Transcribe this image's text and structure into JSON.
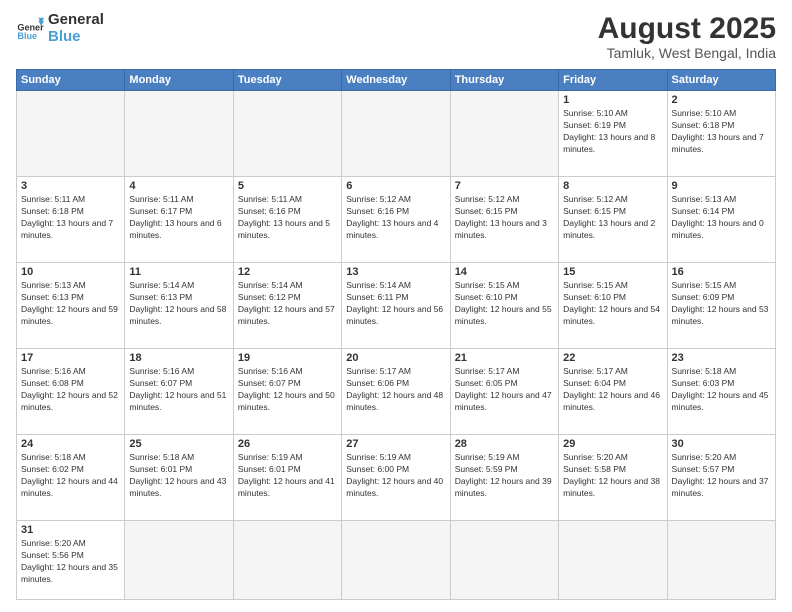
{
  "header": {
    "logo_general": "General",
    "logo_blue": "Blue",
    "title": "August 2025",
    "subtitle": "Tamluk, West Bengal, India"
  },
  "weekdays": [
    "Sunday",
    "Monday",
    "Tuesday",
    "Wednesday",
    "Thursday",
    "Friday",
    "Saturday"
  ],
  "weeks": [
    [
      {
        "day": "",
        "info": ""
      },
      {
        "day": "",
        "info": ""
      },
      {
        "day": "",
        "info": ""
      },
      {
        "day": "",
        "info": ""
      },
      {
        "day": "",
        "info": ""
      },
      {
        "day": "1",
        "info": "Sunrise: 5:10 AM\nSunset: 6:19 PM\nDaylight: 13 hours and 8 minutes."
      },
      {
        "day": "2",
        "info": "Sunrise: 5:10 AM\nSunset: 6:18 PM\nDaylight: 13 hours and 7 minutes."
      }
    ],
    [
      {
        "day": "3",
        "info": "Sunrise: 5:11 AM\nSunset: 6:18 PM\nDaylight: 13 hours and 7 minutes."
      },
      {
        "day": "4",
        "info": "Sunrise: 5:11 AM\nSunset: 6:17 PM\nDaylight: 13 hours and 6 minutes."
      },
      {
        "day": "5",
        "info": "Sunrise: 5:11 AM\nSunset: 6:16 PM\nDaylight: 13 hours and 5 minutes."
      },
      {
        "day": "6",
        "info": "Sunrise: 5:12 AM\nSunset: 6:16 PM\nDaylight: 13 hours and 4 minutes."
      },
      {
        "day": "7",
        "info": "Sunrise: 5:12 AM\nSunset: 6:15 PM\nDaylight: 13 hours and 3 minutes."
      },
      {
        "day": "8",
        "info": "Sunrise: 5:12 AM\nSunset: 6:15 PM\nDaylight: 13 hours and 2 minutes."
      },
      {
        "day": "9",
        "info": "Sunrise: 5:13 AM\nSunset: 6:14 PM\nDaylight: 13 hours and 0 minutes."
      }
    ],
    [
      {
        "day": "10",
        "info": "Sunrise: 5:13 AM\nSunset: 6:13 PM\nDaylight: 12 hours and 59 minutes."
      },
      {
        "day": "11",
        "info": "Sunrise: 5:14 AM\nSunset: 6:13 PM\nDaylight: 12 hours and 58 minutes."
      },
      {
        "day": "12",
        "info": "Sunrise: 5:14 AM\nSunset: 6:12 PM\nDaylight: 12 hours and 57 minutes."
      },
      {
        "day": "13",
        "info": "Sunrise: 5:14 AM\nSunset: 6:11 PM\nDaylight: 12 hours and 56 minutes."
      },
      {
        "day": "14",
        "info": "Sunrise: 5:15 AM\nSunset: 6:10 PM\nDaylight: 12 hours and 55 minutes."
      },
      {
        "day": "15",
        "info": "Sunrise: 5:15 AM\nSunset: 6:10 PM\nDaylight: 12 hours and 54 minutes."
      },
      {
        "day": "16",
        "info": "Sunrise: 5:15 AM\nSunset: 6:09 PM\nDaylight: 12 hours and 53 minutes."
      }
    ],
    [
      {
        "day": "17",
        "info": "Sunrise: 5:16 AM\nSunset: 6:08 PM\nDaylight: 12 hours and 52 minutes."
      },
      {
        "day": "18",
        "info": "Sunrise: 5:16 AM\nSunset: 6:07 PM\nDaylight: 12 hours and 51 minutes."
      },
      {
        "day": "19",
        "info": "Sunrise: 5:16 AM\nSunset: 6:07 PM\nDaylight: 12 hours and 50 minutes."
      },
      {
        "day": "20",
        "info": "Sunrise: 5:17 AM\nSunset: 6:06 PM\nDaylight: 12 hours and 48 minutes."
      },
      {
        "day": "21",
        "info": "Sunrise: 5:17 AM\nSunset: 6:05 PM\nDaylight: 12 hours and 47 minutes."
      },
      {
        "day": "22",
        "info": "Sunrise: 5:17 AM\nSunset: 6:04 PM\nDaylight: 12 hours and 46 minutes."
      },
      {
        "day": "23",
        "info": "Sunrise: 5:18 AM\nSunset: 6:03 PM\nDaylight: 12 hours and 45 minutes."
      }
    ],
    [
      {
        "day": "24",
        "info": "Sunrise: 5:18 AM\nSunset: 6:02 PM\nDaylight: 12 hours and 44 minutes."
      },
      {
        "day": "25",
        "info": "Sunrise: 5:18 AM\nSunset: 6:01 PM\nDaylight: 12 hours and 43 minutes."
      },
      {
        "day": "26",
        "info": "Sunrise: 5:19 AM\nSunset: 6:01 PM\nDaylight: 12 hours and 41 minutes."
      },
      {
        "day": "27",
        "info": "Sunrise: 5:19 AM\nSunset: 6:00 PM\nDaylight: 12 hours and 40 minutes."
      },
      {
        "day": "28",
        "info": "Sunrise: 5:19 AM\nSunset: 5:59 PM\nDaylight: 12 hours and 39 minutes."
      },
      {
        "day": "29",
        "info": "Sunrise: 5:20 AM\nSunset: 5:58 PM\nDaylight: 12 hours and 38 minutes."
      },
      {
        "day": "30",
        "info": "Sunrise: 5:20 AM\nSunset: 5:57 PM\nDaylight: 12 hours and 37 minutes."
      }
    ],
    [
      {
        "day": "31",
        "info": "Sunrise: 5:20 AM\nSunset: 5:56 PM\nDaylight: 12 hours and 35 minutes."
      },
      {
        "day": "",
        "info": ""
      },
      {
        "day": "",
        "info": ""
      },
      {
        "day": "",
        "info": ""
      },
      {
        "day": "",
        "info": ""
      },
      {
        "day": "",
        "info": ""
      },
      {
        "day": "",
        "info": ""
      }
    ]
  ]
}
